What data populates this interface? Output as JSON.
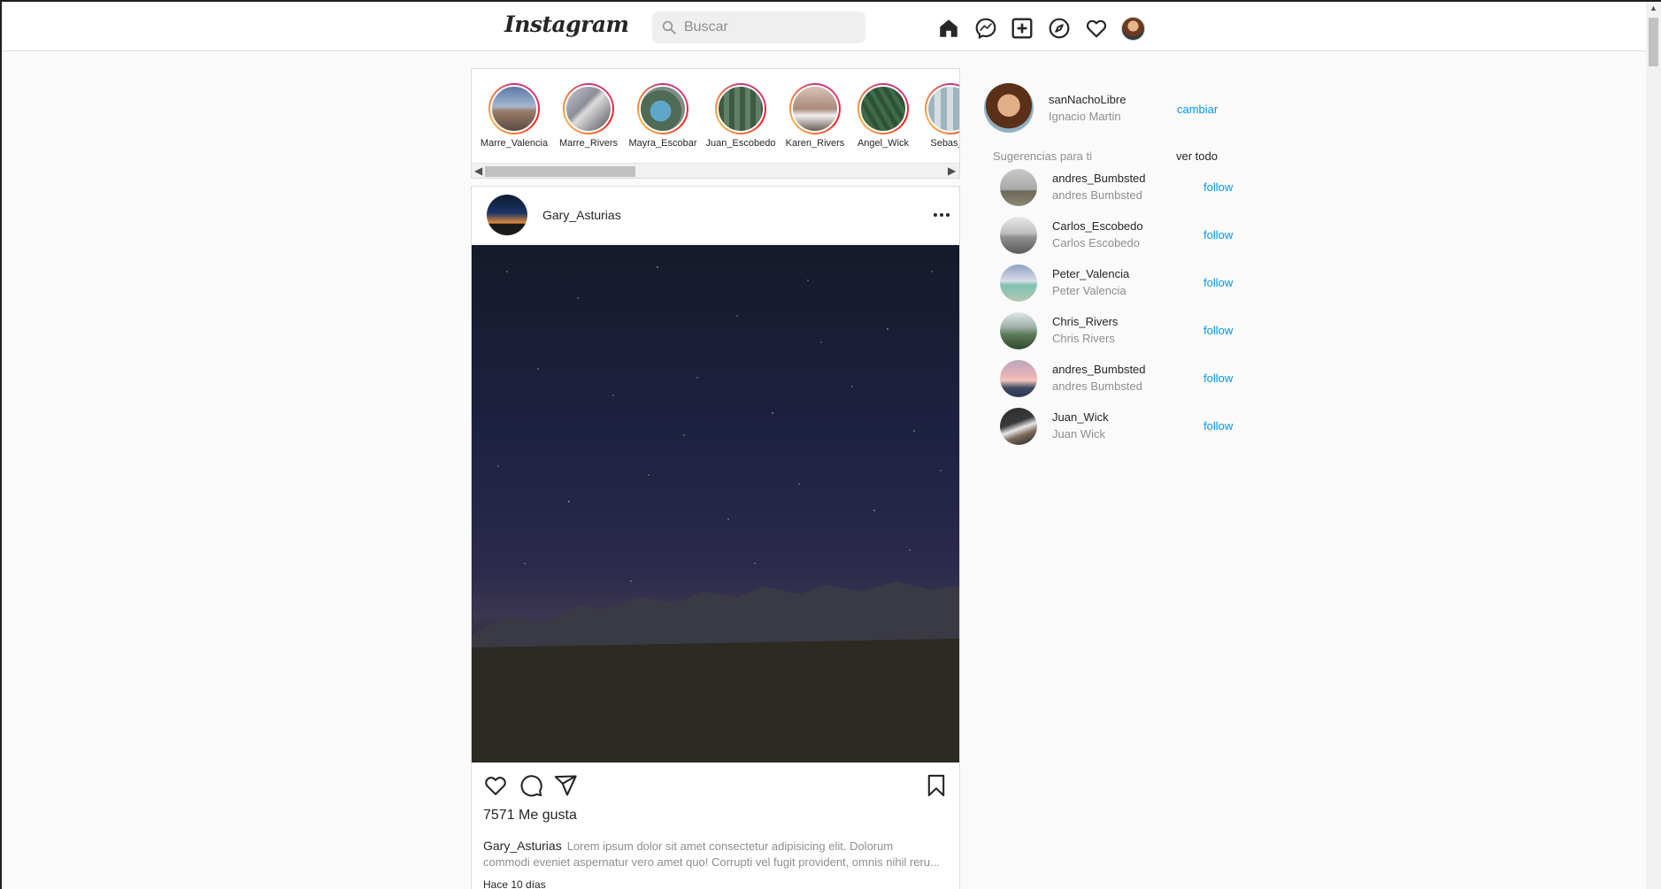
{
  "app": {
    "logo": "Instagram"
  },
  "search": {
    "placeholder": "Buscar"
  },
  "nav": {
    "icons": [
      "home-icon",
      "messenger-icon",
      "new-post-icon",
      "explore-icon",
      "activity-heart-icon",
      "profile-avatar"
    ]
  },
  "stories": [
    {
      "username": "Marre_Valencia"
    },
    {
      "username": "Marre_Rivers"
    },
    {
      "username": "Mayra_Escobar"
    },
    {
      "username": "Juan_Escobedo"
    },
    {
      "username": "Karen_Rivers"
    },
    {
      "username": "Angel_Wick"
    },
    {
      "username": "Sebas_C"
    }
  ],
  "post": {
    "username": "Gary_Asturias",
    "likes": "7571 Me gusta",
    "caption_user": "Gary_Asturias",
    "caption_line1": "Lorem ipsum dolor sit amet consectetur adipisicing elit. Dolorum",
    "caption_line2": "commodi eveniet aspernatur vero amet quo! Corrupti vel fugit provident, omnis nihil reru...",
    "time": "Hace 10 días"
  },
  "sidebar": {
    "me": {
      "username": "sanNachoLibre",
      "name": "Ignacio Martin",
      "switch_label": "cambiar"
    },
    "suggestions_title": "Sugerencias para ti",
    "see_all_label": "ver todo",
    "follow_label": "follow",
    "suggestions": [
      {
        "username": "andres_Bumbsted",
        "name": "andres Bumbsted"
      },
      {
        "username": "Carlos_Escobedo",
        "name": "Carlos Escobedo"
      },
      {
        "username": "Peter_Valencia",
        "name": "Peter Valencia"
      },
      {
        "username": "Chris_Rivers",
        "name": "Chris Rivers"
      },
      {
        "username": "andres_Bumbsted",
        "name": "andres Bumbsted"
      },
      {
        "username": "Juan_Wick",
        "name": "Juan Wick"
      }
    ]
  },
  "colors": {
    "link": "#0095f6",
    "border": "#dbdbdb",
    "muted": "#8e8e8e",
    "background": "#fafafa"
  }
}
